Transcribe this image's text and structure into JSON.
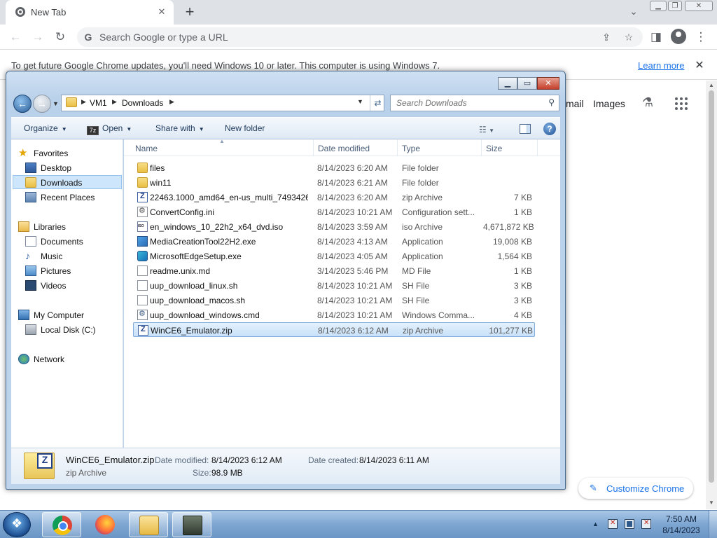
{
  "chrome": {
    "tab": {
      "title": "New Tab"
    },
    "omnibox": {
      "placeholder": "Search Google or type a URL"
    },
    "infobar": {
      "message": "To get future Google Chrome updates, you'll need Windows 10 or later. This computer is using Windows 7.",
      "link": "Learn more"
    },
    "page": {
      "gmail_link": "mail",
      "images_link": "Images",
      "customize_label": "Customize Chrome"
    }
  },
  "explorer": {
    "breadcrumb": [
      "VM1",
      "Downloads"
    ],
    "search_placeholder": "Search Downloads",
    "commands": {
      "organize": "Organize",
      "open": "Open",
      "share_with": "Share with",
      "new_folder": "New folder"
    },
    "nav": {
      "favorites": "Favorites",
      "desktop": "Desktop",
      "downloads": "Downloads",
      "recent_places": "Recent Places",
      "libraries": "Libraries",
      "documents": "Documents",
      "music": "Music",
      "pictures": "Pictures",
      "videos": "Videos",
      "my_computer": "My Computer",
      "local_disk": "Local Disk (C:)",
      "network": "Network"
    },
    "columns": {
      "name": "Name",
      "date": "Date modified",
      "type": "Type",
      "size": "Size"
    },
    "files": [
      {
        "name": "files",
        "date": "8/14/2023 6:20 AM",
        "type": "File folder",
        "size": "",
        "icon": "folder-icon"
      },
      {
        "name": "win11",
        "date": "8/14/2023 6:21 AM",
        "type": "File folder",
        "size": "",
        "icon": "folder-icon"
      },
      {
        "name": "22463.1000_amd64_en-us_multi_7493426...",
        "date": "8/14/2023 6:20 AM",
        "type": "zip Archive",
        "size": "7 KB",
        "icon": "zip-icon"
      },
      {
        "name": "ConvertConfig.ini",
        "date": "8/14/2023 10:21 AM",
        "type": "Configuration sett...",
        "size": "1 KB",
        "icon": "config-icon"
      },
      {
        "name": "en_windows_10_22h2_x64_dvd.iso",
        "date": "8/14/2023 3:59 AM",
        "type": "iso Archive",
        "size": "4,671,872 KB",
        "icon": "iso-icon"
      },
      {
        "name": "MediaCreationTool22H2.exe",
        "date": "8/14/2023 4:13 AM",
        "type": "Application",
        "size": "19,008 KB",
        "icon": "app-icon"
      },
      {
        "name": "MicrosoftEdgeSetup.exe",
        "date": "8/14/2023 4:05 AM",
        "type": "Application",
        "size": "1,564 KB",
        "icon": "edge-icon"
      },
      {
        "name": "readme.unix.md",
        "date": "3/14/2023 5:46 PM",
        "type": "MD File",
        "size": "1 KB",
        "icon": "document-icon"
      },
      {
        "name": "uup_download_linux.sh",
        "date": "8/14/2023 10:21 AM",
        "type": "SH File",
        "size": "3 KB",
        "icon": "document-icon"
      },
      {
        "name": "uup_download_macos.sh",
        "date": "8/14/2023 10:21 AM",
        "type": "SH File",
        "size": "3 KB",
        "icon": "document-icon"
      },
      {
        "name": "uup_download_windows.cmd",
        "date": "8/14/2023 10:21 AM",
        "type": "Windows Comma...",
        "size": "4 KB",
        "icon": "cmd-icon"
      },
      {
        "name": "WinCE6_Emulator.zip",
        "date": "8/14/2023 6:12 AM",
        "type": "zip Archive",
        "size": "101,277 KB",
        "icon": "zip-icon"
      }
    ],
    "details": {
      "name": "WinCE6_Emulator.zip",
      "type": "zip Archive",
      "date_modified_label": "Date modified:",
      "date_modified": "8/14/2023 6:12 AM",
      "date_created_label": "Date created:",
      "date_created": "8/14/2023 6:11 AM",
      "size_label": "Size:",
      "size": "98.9 MB"
    }
  },
  "taskbar": {
    "time": "7:50 AM",
    "date": "8/14/2023"
  }
}
